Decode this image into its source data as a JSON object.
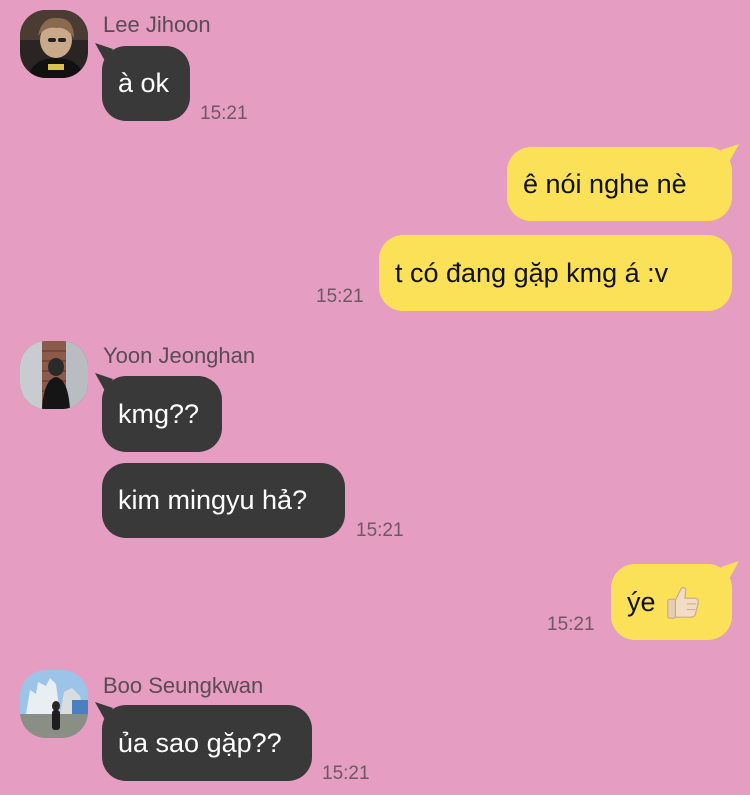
{
  "colors": {
    "background": "#e59dc1",
    "incoming_bubble": "#393939",
    "outgoing_bubble": "#fbe157"
  },
  "messages": {
    "m1": {
      "sender": "Lee Jihoon",
      "text": "à ok",
      "time": "15:21"
    },
    "m2": {
      "text": "ê nói nghe nè"
    },
    "m3": {
      "text": "t có đang gặp kmg á :v",
      "time": "15:21"
    },
    "m4": {
      "sender": "Yoon Jeonghan",
      "text": "kmg??"
    },
    "m5": {
      "text": "kim mingyu hả?",
      "time": "15:21"
    },
    "m6": {
      "text": "ýe",
      "emoji": "thumbs-up",
      "time": "15:21"
    },
    "m7": {
      "sender": "Boo Seungkwan",
      "text": "ủa sao gặp??",
      "time": "15:21"
    }
  }
}
